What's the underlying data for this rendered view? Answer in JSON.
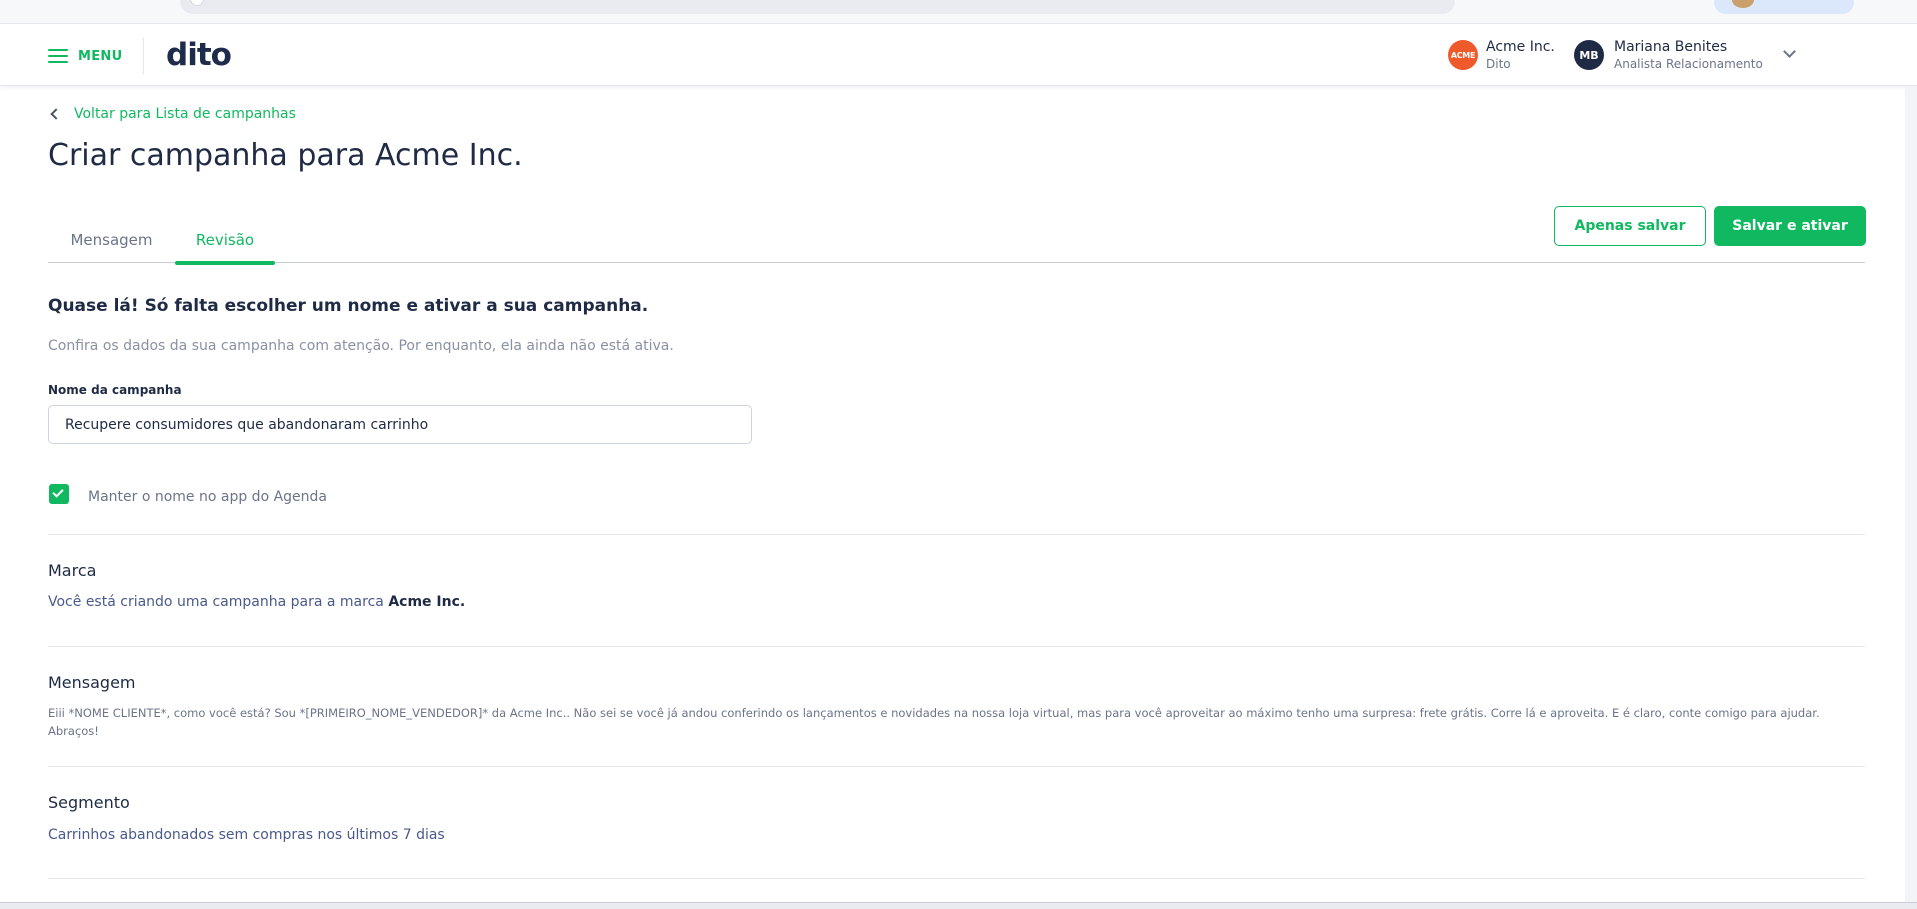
{
  "header": {
    "menu_label": "MENU",
    "logo_text": "dito",
    "company": {
      "logo_text": "ACME",
      "name": "Acme Inc.",
      "sub": "Dito"
    },
    "user": {
      "initials": "MB",
      "name": "Mariana Benites",
      "role": "Analista Relacionamento"
    }
  },
  "nav": {
    "back_label": "Voltar para Lista de campanhas"
  },
  "page": {
    "title": "Criar campanha para Acme Inc."
  },
  "tabs": [
    {
      "label": "Mensagem",
      "active": false
    },
    {
      "label": "Revisão",
      "active": true
    }
  ],
  "actions": {
    "save_only": "Apenas salvar",
    "save_activate": "Salvar e ativar"
  },
  "intro": {
    "title": "Quase lá! Só falta escolher um nome e ativar a sua campanha.",
    "subtitle": "Confira os dados da sua campanha com atenção. Por enquanto, ela ainda não está ativa."
  },
  "form": {
    "name_label": "Nome da campanha",
    "name_value": "Recupere consumidores que abandonaram carrinho",
    "keep_name_label": "Manter o nome no app do Agenda",
    "keep_name_checked": true
  },
  "sections": {
    "brand": {
      "title": "Marca",
      "text_prefix": "Você está criando uma campanha para a marca ",
      "brand_name": "Acme Inc."
    },
    "message": {
      "title": "Mensagem",
      "text": "Eiii *NOME CLIENTE*, como você está? Sou *[PRIMEIRO_NOME_VENDEDOR]* da Acme Inc.. Não sei se você já andou conferindo os lançamentos e novidades na nossa loja virtual, mas para você aproveitar ao máximo tenho uma surpresa: frete grátis. Corre lá e aproveita. E é claro, conte comigo para ajudar. Abraços!"
    },
    "segment": {
      "title": "Segmento",
      "text": "Carrinhos abandonados sem compras nos últimos 7 dias"
    }
  },
  "colors": {
    "accent": "#10b960",
    "text": "#1f2a44",
    "muted": "#6b7488",
    "brand_logo": "#ee5a2a"
  }
}
